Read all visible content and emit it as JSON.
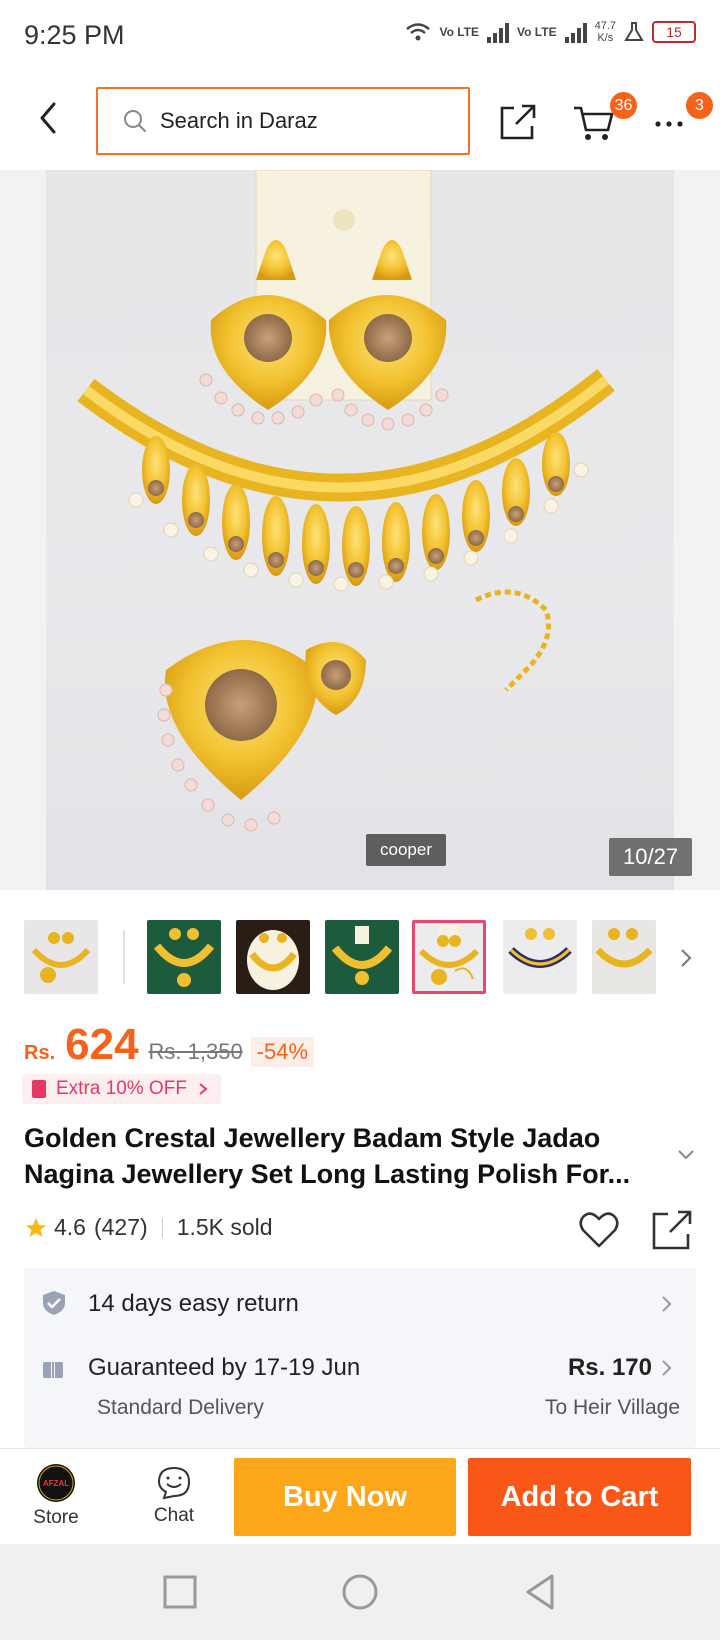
{
  "status_bar": {
    "time": "9:25 PM",
    "network1": "Vo LTE",
    "network2": "Vo LTE",
    "speed_value": "47.7",
    "speed_unit": "K/s",
    "battery": "15"
  },
  "header": {
    "search_placeholder": "Search in Daraz",
    "cart_count": "36",
    "more_count": "3"
  },
  "gallery": {
    "watermark": "cooper",
    "counter": "10/27",
    "thumbnails": [
      {
        "bg": "#e8e6e6"
      },
      {
        "bg": "#1d5b3d"
      },
      {
        "bg": "#2a1d16"
      },
      {
        "bg": "#1d5b3d"
      },
      {
        "bg": "#ecebee",
        "active": true
      },
      {
        "bg": "#2b2d69"
      },
      {
        "bg": "#e9e7e4"
      }
    ]
  },
  "product": {
    "currency": "Rs.",
    "price": "624",
    "original_price": "Rs. 1,350",
    "discount": "-54%",
    "voucher": "Extra 10% OFF",
    "title": "Golden Crestal Jewellery Badam Style Jadao Nagina Jewellery Set Long Lasting Polish For...",
    "rating": "4.6",
    "reviews": "(427)",
    "sold": "1.5K sold"
  },
  "service": {
    "returns": "14 days easy return",
    "delivery_guarantee": "Guaranteed by 17-19 Jun",
    "delivery_type": "Standard Delivery",
    "delivery_fee": "Rs. 170",
    "delivery_location": "To Heir Village"
  },
  "actions": {
    "store_label": "Store",
    "store_logo_text": "AFZAL",
    "chat_label": "Chat",
    "buy_now": "Buy Now",
    "add_to_cart": "Add to Cart"
  },
  "colors": {
    "accent": "#f5631a",
    "buy_now": "#fca61a",
    "add_to_cart": "#f85718",
    "voucher": "#e63962"
  }
}
